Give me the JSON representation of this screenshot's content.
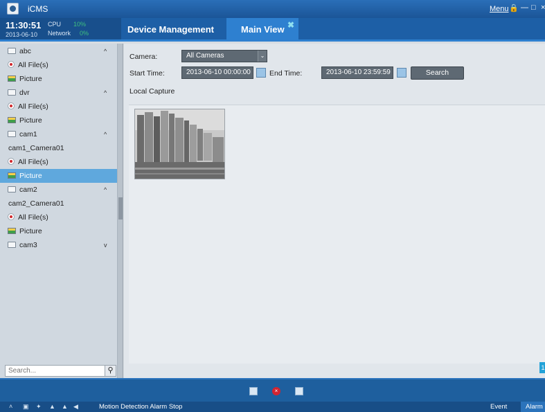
{
  "window": {
    "title": "iCMS",
    "menu": "Menu"
  },
  "header": {
    "time": "11:30:51",
    "date": "2013-06-10",
    "cpu_label": "CPU",
    "cpu_value": "10%",
    "network_label": "Network",
    "network_value": "0%",
    "tabs": [
      {
        "label": "Device Management",
        "active": false
      },
      {
        "label": "Main View",
        "active": true
      }
    ]
  },
  "sidebar": {
    "items": [
      {
        "label": "abc",
        "icon": "folder-icon",
        "chevron": "^"
      },
      {
        "label": "All File(s)",
        "icon": "record-icon"
      },
      {
        "label": "Picture",
        "icon": "picture-icon"
      },
      {
        "label": "dvr",
        "icon": "folder-icon",
        "chevron": "^"
      },
      {
        "label": "All File(s)",
        "icon": "record-icon"
      },
      {
        "label": "Picture",
        "icon": "picture-icon"
      },
      {
        "label": "cam1",
        "icon": "folder-icon",
        "chevron": "^"
      },
      {
        "label": "cam1_Camera01",
        "icon": ""
      },
      {
        "label": "All File(s)",
        "icon": "record-icon"
      },
      {
        "label": "Picture",
        "icon": "picture-icon",
        "selected": true
      },
      {
        "label": "cam2",
        "icon": "folder-icon",
        "chevron": "^"
      },
      {
        "label": "cam2_Camera01",
        "icon": ""
      },
      {
        "label": "All File(s)",
        "icon": "record-icon"
      },
      {
        "label": "Picture",
        "icon": "picture-icon"
      },
      {
        "label": "cam3",
        "icon": "folder-icon",
        "chevron": "v"
      }
    ],
    "search_placeholder": "Search..."
  },
  "filters": {
    "camera_label": "Camera:",
    "camera_value": "All Cameras",
    "start_label": "Start Time:",
    "start_value": "2013-06-10 00:00:00",
    "end_label": "End Time:",
    "end_value": "2013-06-10 23:59:59",
    "search_button": "Search"
  },
  "capture": {
    "section_label": "Local Capture",
    "page": "1"
  },
  "statusbar": {
    "message": "Motion Detection Alarm Stop",
    "event_tab": "Event",
    "alarm_tab": "Alarm"
  },
  "colors": {
    "accent": "#2e80d0",
    "selected": "#5fa8dd",
    "titlebar": "#1d5fa6"
  }
}
